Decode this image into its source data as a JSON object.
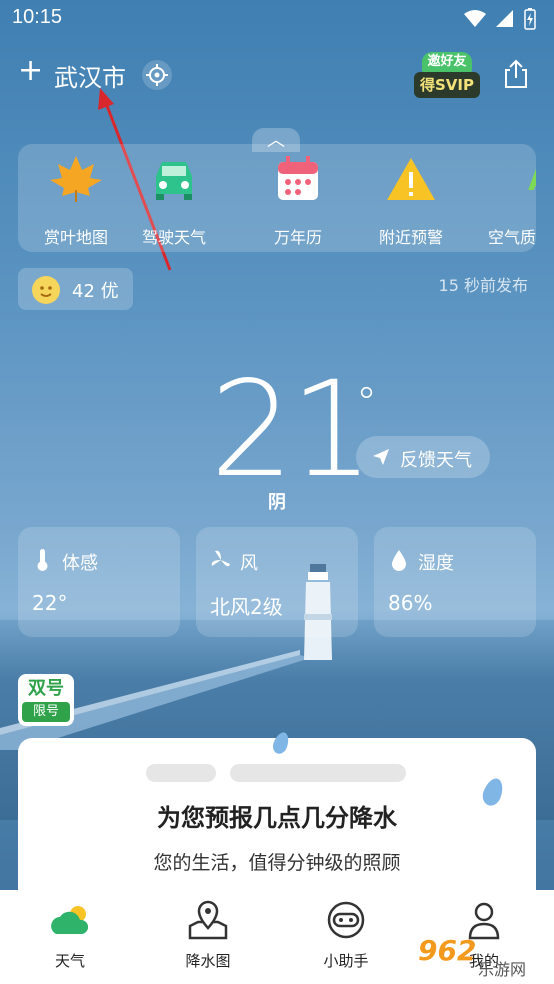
{
  "status": {
    "time": "10:15"
  },
  "header": {
    "add_symbol": "+",
    "city": "武汉市",
    "vip_top": "邀好友",
    "vip_bottom": "得SVIP"
  },
  "quick_tools": [
    {
      "label": "赏叶地图",
      "icon": "maple-leaf-icon"
    },
    {
      "label": "驾驶天气",
      "icon": "car-icon"
    },
    {
      "label": "万年历",
      "icon": "calendar-icon"
    },
    {
      "label": "附近预警",
      "icon": "warning-icon"
    },
    {
      "label": "空气质",
      "icon": "aqi-icon"
    }
  ],
  "aqi": {
    "text": "42 优"
  },
  "publish_time": "15 秒前发布",
  "weather": {
    "temperature": "21",
    "degree": "°",
    "condition": "阴"
  },
  "feedback": {
    "label": "反馈天气"
  },
  "cards": [
    {
      "label": "体感",
      "value": "22°",
      "icon": "thermometer-icon"
    },
    {
      "label": "风",
      "value": "北风2级",
      "icon": "wind-icon"
    },
    {
      "label": "湿度",
      "value": "86%",
      "icon": "humidity-drop-icon"
    }
  ],
  "traffic_limit": {
    "top": "双号",
    "bottom": "限号"
  },
  "promo": {
    "title": "为您预报几点几分降水",
    "subtitle": "您的生活，值得分钟级的照顾"
  },
  "nav": [
    {
      "label": "天气",
      "icon": "weather-icon"
    },
    {
      "label": "降水图",
      "icon": "map-pin-icon"
    },
    {
      "label": "小助手",
      "icon": "assistant-icon"
    },
    {
      "label": "我的",
      "icon": "profile-icon"
    }
  ],
  "watermark": {
    "number": "962",
    "text": "乐游网"
  },
  "colors": {
    "accent_green": "#2fa24a",
    "annotation_arrow": "#d9272e"
  }
}
